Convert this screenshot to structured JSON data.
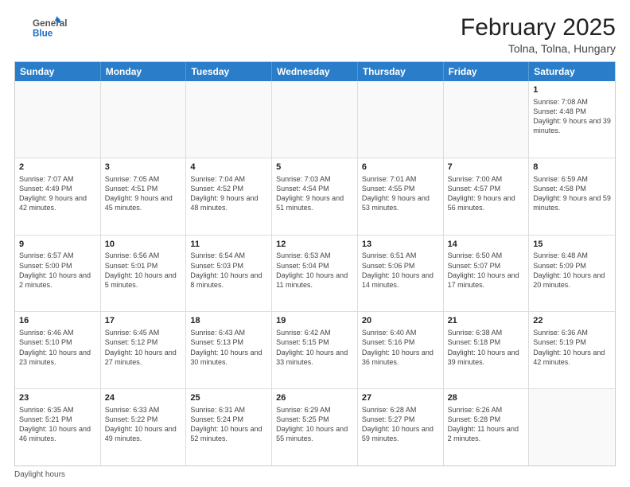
{
  "header": {
    "logo_general": "General",
    "logo_blue": "Blue",
    "month_year": "February 2025",
    "location": "Tolna, Tolna, Hungary"
  },
  "days_of_week": [
    "Sunday",
    "Monday",
    "Tuesday",
    "Wednesday",
    "Thursday",
    "Friday",
    "Saturday"
  ],
  "weeks": [
    [
      {
        "day": "",
        "info": ""
      },
      {
        "day": "",
        "info": ""
      },
      {
        "day": "",
        "info": ""
      },
      {
        "day": "",
        "info": ""
      },
      {
        "day": "",
        "info": ""
      },
      {
        "day": "",
        "info": ""
      },
      {
        "day": "1",
        "info": "Sunrise: 7:08 AM\nSunset: 4:48 PM\nDaylight: 9 hours and 39 minutes."
      }
    ],
    [
      {
        "day": "2",
        "info": "Sunrise: 7:07 AM\nSunset: 4:49 PM\nDaylight: 9 hours and 42 minutes."
      },
      {
        "day": "3",
        "info": "Sunrise: 7:05 AM\nSunset: 4:51 PM\nDaylight: 9 hours and 45 minutes."
      },
      {
        "day": "4",
        "info": "Sunrise: 7:04 AM\nSunset: 4:52 PM\nDaylight: 9 hours and 48 minutes."
      },
      {
        "day": "5",
        "info": "Sunrise: 7:03 AM\nSunset: 4:54 PM\nDaylight: 9 hours and 51 minutes."
      },
      {
        "day": "6",
        "info": "Sunrise: 7:01 AM\nSunset: 4:55 PM\nDaylight: 9 hours and 53 minutes."
      },
      {
        "day": "7",
        "info": "Sunrise: 7:00 AM\nSunset: 4:57 PM\nDaylight: 9 hours and 56 minutes."
      },
      {
        "day": "8",
        "info": "Sunrise: 6:59 AM\nSunset: 4:58 PM\nDaylight: 9 hours and 59 minutes."
      }
    ],
    [
      {
        "day": "9",
        "info": "Sunrise: 6:57 AM\nSunset: 5:00 PM\nDaylight: 10 hours and 2 minutes."
      },
      {
        "day": "10",
        "info": "Sunrise: 6:56 AM\nSunset: 5:01 PM\nDaylight: 10 hours and 5 minutes."
      },
      {
        "day": "11",
        "info": "Sunrise: 6:54 AM\nSunset: 5:03 PM\nDaylight: 10 hours and 8 minutes."
      },
      {
        "day": "12",
        "info": "Sunrise: 6:53 AM\nSunset: 5:04 PM\nDaylight: 10 hours and 11 minutes."
      },
      {
        "day": "13",
        "info": "Sunrise: 6:51 AM\nSunset: 5:06 PM\nDaylight: 10 hours and 14 minutes."
      },
      {
        "day": "14",
        "info": "Sunrise: 6:50 AM\nSunset: 5:07 PM\nDaylight: 10 hours and 17 minutes."
      },
      {
        "day": "15",
        "info": "Sunrise: 6:48 AM\nSunset: 5:09 PM\nDaylight: 10 hours and 20 minutes."
      }
    ],
    [
      {
        "day": "16",
        "info": "Sunrise: 6:46 AM\nSunset: 5:10 PM\nDaylight: 10 hours and 23 minutes."
      },
      {
        "day": "17",
        "info": "Sunrise: 6:45 AM\nSunset: 5:12 PM\nDaylight: 10 hours and 27 minutes."
      },
      {
        "day": "18",
        "info": "Sunrise: 6:43 AM\nSunset: 5:13 PM\nDaylight: 10 hours and 30 minutes."
      },
      {
        "day": "19",
        "info": "Sunrise: 6:42 AM\nSunset: 5:15 PM\nDaylight: 10 hours and 33 minutes."
      },
      {
        "day": "20",
        "info": "Sunrise: 6:40 AM\nSunset: 5:16 PM\nDaylight: 10 hours and 36 minutes."
      },
      {
        "day": "21",
        "info": "Sunrise: 6:38 AM\nSunset: 5:18 PM\nDaylight: 10 hours and 39 minutes."
      },
      {
        "day": "22",
        "info": "Sunrise: 6:36 AM\nSunset: 5:19 PM\nDaylight: 10 hours and 42 minutes."
      }
    ],
    [
      {
        "day": "23",
        "info": "Sunrise: 6:35 AM\nSunset: 5:21 PM\nDaylight: 10 hours and 46 minutes."
      },
      {
        "day": "24",
        "info": "Sunrise: 6:33 AM\nSunset: 5:22 PM\nDaylight: 10 hours and 49 minutes."
      },
      {
        "day": "25",
        "info": "Sunrise: 6:31 AM\nSunset: 5:24 PM\nDaylight: 10 hours and 52 minutes."
      },
      {
        "day": "26",
        "info": "Sunrise: 6:29 AM\nSunset: 5:25 PM\nDaylight: 10 hours and 55 minutes."
      },
      {
        "day": "27",
        "info": "Sunrise: 6:28 AM\nSunset: 5:27 PM\nDaylight: 10 hours and 59 minutes."
      },
      {
        "day": "28",
        "info": "Sunrise: 6:26 AM\nSunset: 5:28 PM\nDaylight: 11 hours and 2 minutes."
      },
      {
        "day": "",
        "info": ""
      }
    ]
  ],
  "footer": {
    "note": "Daylight hours"
  }
}
